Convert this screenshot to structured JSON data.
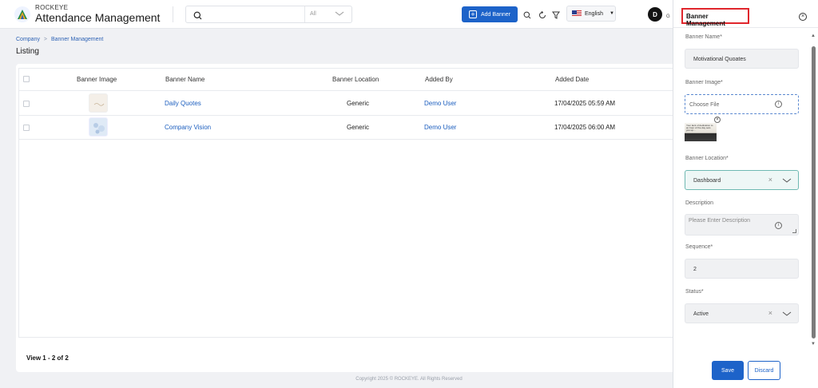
{
  "header": {
    "brand_small": "ROCKEYE",
    "brand_title": "Attendance Management",
    "search_scope": "All",
    "add_banner_label": "Add Banner",
    "language": "English",
    "avatar_initial": "D",
    "avatar_tail": "G"
  },
  "breadcrumb": {
    "root": "Company",
    "current": "Banner Management"
  },
  "page_title": "Listing",
  "table": {
    "columns": [
      "Banner Image",
      "Banner Name",
      "Banner Location",
      "Added By",
      "Added Date"
    ],
    "rows": [
      {
        "name": "Daily Quotes",
        "location": "Generic",
        "added_by": "Demo User",
        "added_date": "17/04/2025 05:59 AM"
      },
      {
        "name": "Company Vision",
        "location": "Generic",
        "added_by": "Demo User",
        "added_date": "17/04/2025 06:00 AM"
      }
    ],
    "view_count": "View 1 - 2 of 2"
  },
  "footer": {
    "copyright": "Copyright 2025 © ROCKEYE. All Rights Reserved"
  },
  "drawer": {
    "title": "Banner Management",
    "banner_name_label": "Banner Name*",
    "banner_name_value": "Motivational Quoates",
    "banner_image_label": "Banner Image*",
    "choose_file_label": "Choose File",
    "preview_text": "Your lack of dedication to an hour of the day sets you up...",
    "banner_location_label": "Banner Location*",
    "banner_location_value": "Dashboard",
    "description_label": "Description",
    "description_placeholder": "Please Enter Description",
    "sequence_label": "Sequence*",
    "sequence_value": "2",
    "status_label": "Status*",
    "status_value": "Active",
    "save_label": "Save",
    "discard_label": "Discard"
  },
  "colors": {
    "primary": "#1d63c9",
    "link": "#1d5fbf",
    "highlight": "#e0262c",
    "teal": "#6fb9b2"
  }
}
